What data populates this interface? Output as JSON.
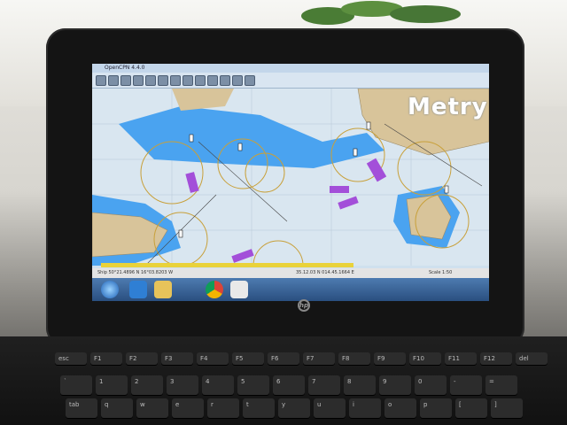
{
  "scene": {
    "app_title": "OpenCPN 4.4.0",
    "map_overlay_label": "Metry",
    "brand_logo_text": "hp",
    "status": {
      "left": "Ship 50°21.4896 N 16°03.8203 W",
      "center": "35.12.03 N 014.45.1664 E",
      "right": "Scale 1:50"
    },
    "keyboard_rows": [
      [
        "esc",
        "F1",
        "F2",
        "F3",
        "F4",
        "F5",
        "F6",
        "F7",
        "F8",
        "F9",
        "F10",
        "F11",
        "F12",
        "del"
      ],
      [
        "`",
        "1",
        "2",
        "3",
        "4",
        "5",
        "6",
        "7",
        "8",
        "9",
        "0",
        "-",
        "="
      ],
      [
        "tab",
        "q",
        "w",
        "e",
        "r",
        "t",
        "y",
        "u",
        "i",
        "o",
        "p",
        "[",
        "]"
      ]
    ],
    "colors": {
      "sea": "#cfe0ee",
      "shallow": "#4aa3f0",
      "land": "#d8c49a",
      "range_ring": "#c8a03a",
      "restricted": "#a34fd9",
      "taskbar": "#2a4f80"
    },
    "taskbar_icons": [
      "start-orb-icon",
      "ie-icon",
      "folder-icon",
      "chrome-icon",
      "opencpn-icon"
    ]
  }
}
